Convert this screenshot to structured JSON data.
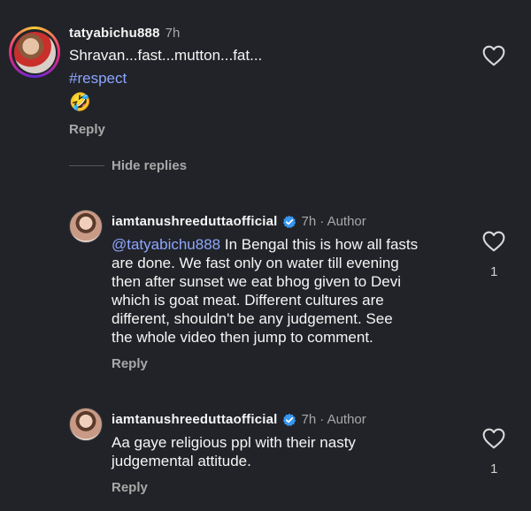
{
  "comments": [
    {
      "username": "tatyabichu888",
      "time": "7h",
      "text": "Shravan...fast...mutton...fat...",
      "hashtag": "#respect",
      "emoji": "🤣",
      "reply_label": "Reply",
      "likes": ""
    },
    {
      "username": "iamtanushreeduttaofficial",
      "time": "7h",
      "author_label": "· Author",
      "mention": "@tatyabichu888",
      "lines": [
        " In Bengal this is how all fasts",
        "are done. We fast only on water till evening",
        "then after sunset we eat bhog given to Devi",
        "which is goat meat. Different cultures are",
        "different, shouldn't be any judgement. See",
        "the whole video then jump to comment."
      ],
      "reply_label": "Reply",
      "likes": "1"
    },
    {
      "username": "iamtanushreeduttaofficial",
      "time": "7h",
      "author_label": "· Author",
      "lines": [
        "Aa gaye religious ppl with their nasty",
        "judgemental attitude."
      ],
      "reply_label": "Reply",
      "likes": "1"
    }
  ],
  "hide_replies_label": "Hide replies",
  "colors": {
    "background": "#212328",
    "mention": "#8ea6ff",
    "verified": "#3897f0"
  },
  "icons": [
    "heart-icon",
    "verified-badge-icon"
  ]
}
